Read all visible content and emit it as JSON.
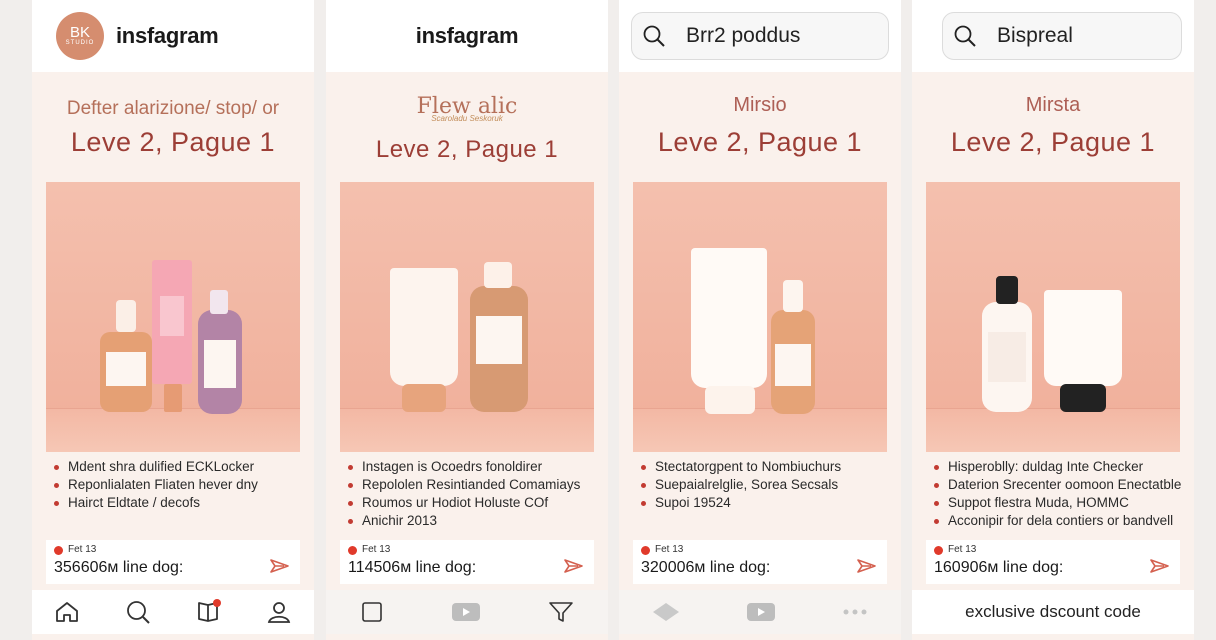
{
  "panels": [
    {
      "logo": {
        "big": "BK",
        "small": "STUDIO"
      },
      "brand": "insfagram",
      "subtitle": "Defter alarizione/ stop/ or",
      "headline": "Leve 2, Pague 1",
      "bullets": [
        "Mdent shra dulified ECKLocker",
        "Reponlialaten Fliaten hever dny",
        "Hairct Eldtate / decofs"
      ],
      "promo": {
        "date": "Fet 13",
        "count": "356606м line dog:"
      },
      "nav_icons": [
        "home-icon",
        "search-icon",
        "bookmark-icon",
        "profile-icon"
      ]
    },
    {
      "brand": "insfagram",
      "subtitle": "Flew alic",
      "tagline": "Scaroladu Seskoruk",
      "headline": "Leve 2, Pague 1",
      "bullets": [
        "Instagen is Ocoedrs fonoldirer",
        "Repololen Resintianded Comamiays",
        "Roumos ur Hodiot Holuste COf",
        "Anichir 2013"
      ],
      "promo": {
        "date": "Fet 13",
        "count": "114506м line dog:"
      },
      "nav_icons": [
        "square-icon",
        "video-icon",
        "filter-icon"
      ]
    },
    {
      "search": "Brr2 poddus",
      "subtitle": "Mirsio",
      "headline": "Leve 2, Pague 1",
      "bullets": [
        "Stectatorgpent to Nombiuchurs",
        "Suepaialrelglie, Sorea Secsals",
        "Supoi 19524"
      ],
      "promo": {
        "date": "Fet 13",
        "count": "320006м line dog:"
      },
      "nav_icons": [
        "diamond-icon",
        "video-icon",
        "more-icon"
      ]
    },
    {
      "search": "Bispreal",
      "subtitle": "Mirsta",
      "headline": "Leve 2, Pague 1",
      "bullets": [
        "Hisperoblly: duldag Inte Checker",
        "Daterion Srecenter oomoon Enectatble",
        "Suppot flestra Muda, HOMMC",
        "Acconipir for dela contiers or bandvell"
      ],
      "promo": {
        "date": "Fet 13",
        "count": "160906м line dog:"
      },
      "bottom_text": "exclusive dscount code"
    }
  ],
  "colors": {
    "accent": "#9c3e36",
    "photo_bg": "#f0ae99",
    "panel_bg": "#faf1ec",
    "dot": "#e03a2b"
  }
}
